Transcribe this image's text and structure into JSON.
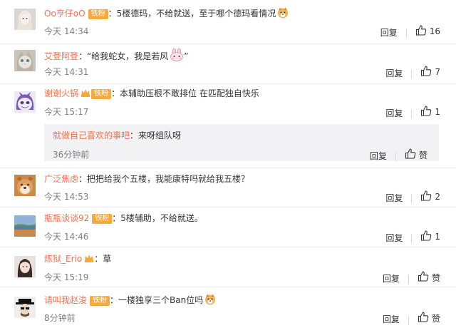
{
  "colors": {
    "username": "#eb7350",
    "badge": "#f7a93a",
    "time": "#808080",
    "reply_bg": "#f2f2f5"
  },
  "comments": [
    {
      "user": "Oo亨仔oO",
      "badge": "铁粉",
      "text": "5楼德玛，不给就送，至于哪个德玛看情况",
      "emoji": "dog-emoji",
      "time": "今天 14:34",
      "reply_label": "回复",
      "like_count": "16"
    },
    {
      "user": "艾登阿登",
      "text": "“给我蛇女，我是若风",
      "text_tail": "”",
      "emoji": "rabbit-emoji",
      "time": "今天 14:31",
      "reply_label": "回复",
      "like_count": "7"
    },
    {
      "user": "谢谢火锅",
      "badge": "铁粉",
      "text": "本辅助压根不敢排位 在匹配独自快乐",
      "time": "今天 15:17",
      "reply_label": "回复",
      "like_count": "1",
      "sub_reply": {
        "user": "就做自己喜欢的事吧",
        "text": "来呀组队呀",
        "time": "36分钟前",
        "reply_label": "回复",
        "like_label": "赞"
      }
    },
    {
      "user": "广泛焦虑",
      "text": "把把给我个五楼，我能康特吗就给我五楼？",
      "time": "今天 14:53",
      "reply_label": "回复",
      "like_count": "2"
    },
    {
      "user": "瓶瓶谈谈92",
      "badge": "铁粉",
      "text": "5楼辅助，不给就送。",
      "time": "今天 14:46",
      "reply_label": "回复",
      "like_count": "1"
    },
    {
      "user": "炼狱_Erio",
      "text": "草",
      "time": "今天 15:19",
      "reply_label": "回复",
      "like_label": "赞"
    },
    {
      "user": "请叫我赵浚",
      "badge": "铁粉",
      "text": "一楼独享三个Ban位吗",
      "emoji": "dog-emoji",
      "time": "8分钟前",
      "reply_label": "回复",
      "like_label": "赞"
    }
  ]
}
